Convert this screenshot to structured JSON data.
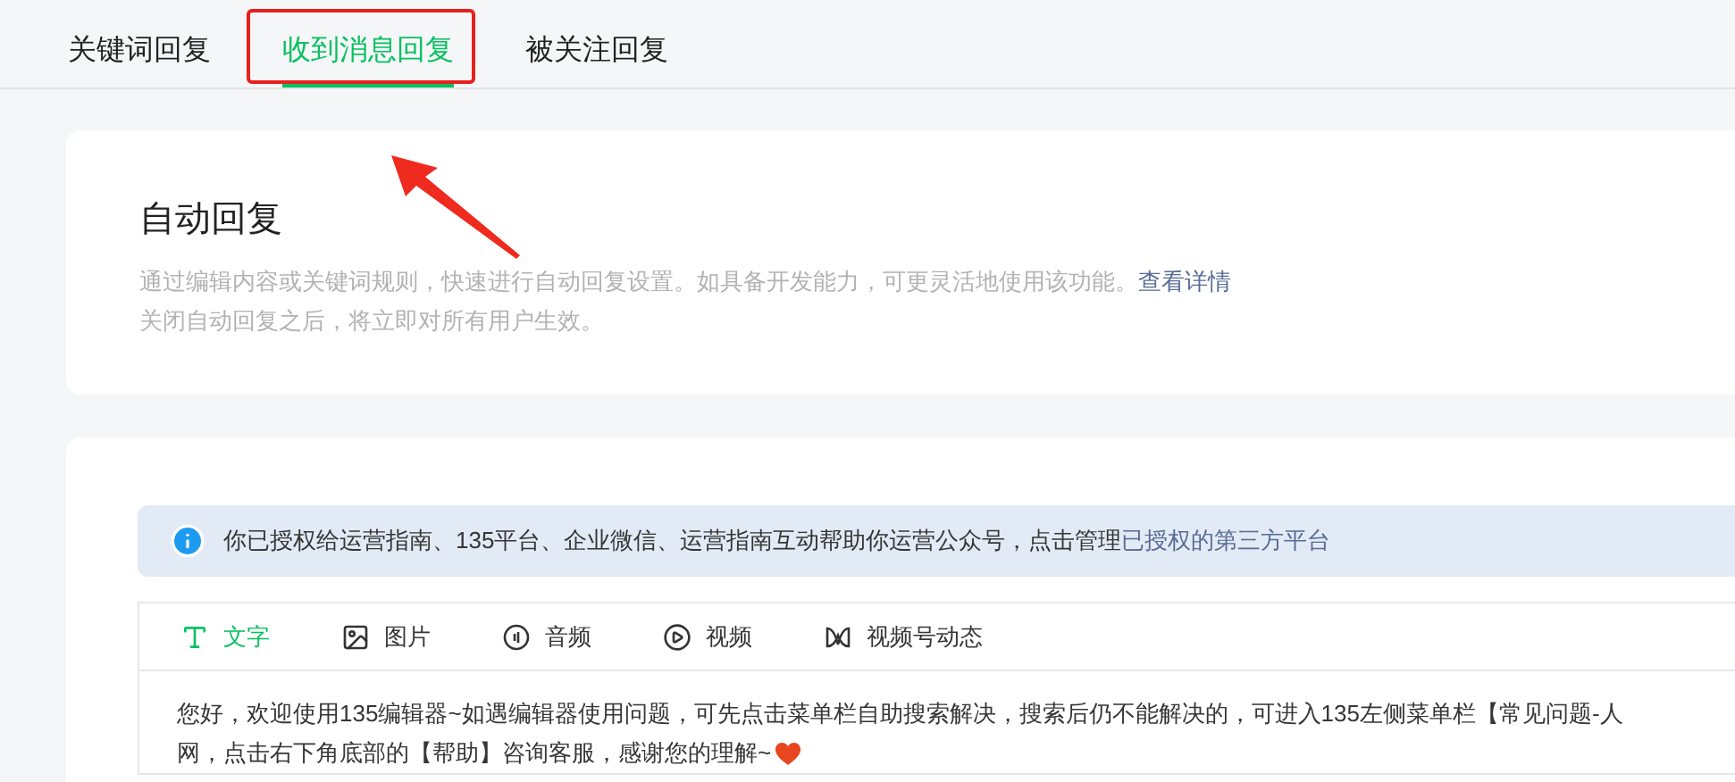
{
  "tabs": [
    {
      "label": "关键词回复",
      "selected": false
    },
    {
      "label": "收到消息回复",
      "selected": true,
      "marked": true
    },
    {
      "label": "被关注回复",
      "selected": false
    }
  ],
  "intro": {
    "title": "自动回复",
    "description": "通过编辑内容或关键词规则，快速进行自动回复设置。如具备开发能力，可更灵活地使用该功能。",
    "link": "查看详情",
    "note": "关闭自动回复之后，将立即对所有用户生效。"
  },
  "notice": {
    "text": "你已授权给运营指南、135平台、企业微信、运营指南互动帮助你运营公众号，点击管理",
    "link": "已授权的第三方平台"
  },
  "editor_tabs": [
    {
      "label": "文字",
      "kind": "text",
      "selected": true
    },
    {
      "label": "图片",
      "kind": "image",
      "selected": false
    },
    {
      "label": "音频",
      "kind": "audio",
      "selected": false
    },
    {
      "label": "视频",
      "kind": "video",
      "selected": false
    },
    {
      "label": "视频号动态",
      "kind": "channels",
      "selected": false
    }
  ],
  "message_lines": [
    "您好，欢迎使用135编辑器~如遇编辑器使用问题，可先点击菜单栏自助搜索解决，搜索后仍不能解决的，可进入135左侧菜单栏【常见问题-人",
    "网，点击右下角底部的【帮助】咨询客服，感谢您的理解~"
  ]
}
